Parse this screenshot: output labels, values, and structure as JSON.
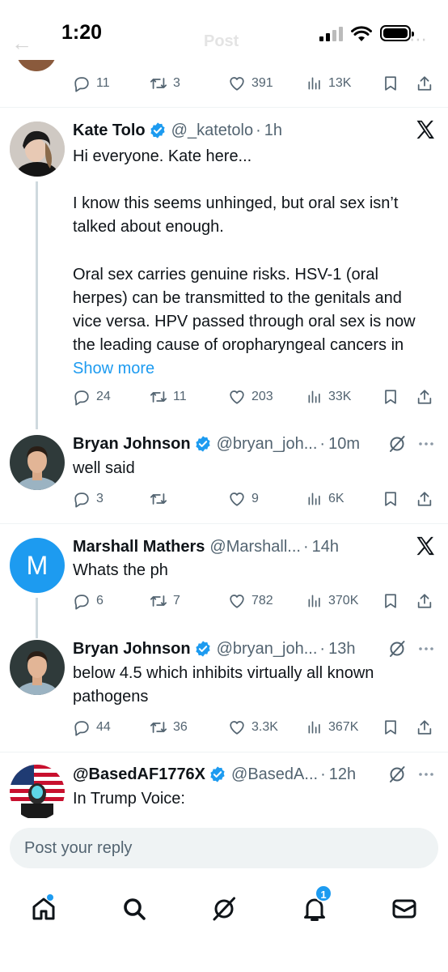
{
  "status_bar": {
    "time": "1:20"
  },
  "header": {
    "title": "Post"
  },
  "top_actions": {
    "replies": "11",
    "reposts": "3",
    "likes": "391",
    "views": "13K"
  },
  "tweets": [
    {
      "name": "Kate Tolo",
      "verified": true,
      "handle": "@_katetolo",
      "time": "1h",
      "paragraphs": [
        "Hi everyone. Kate here...",
        "I know this seems unhinged, but oral sex isn’t talked about enough.",
        "Oral sex carries genuine risks. HSV-1 (oral herpes) can be transmitted to the genitals and vice versa. HPV passed through oral sex is now the leading cause of oropharyngeal cancers in"
      ],
      "show_more": "Show more",
      "actions": {
        "replies": "24",
        "reposts": "11",
        "likes": "203",
        "views": "33K"
      }
    },
    {
      "name": "Bryan Johnson",
      "verified": true,
      "handle": "@bryan_joh...",
      "time": "10m",
      "text": "well said",
      "actions": {
        "replies": "3",
        "reposts": "",
        "likes": "9",
        "views": "6K"
      }
    },
    {
      "name": "Marshall Mathers",
      "verified": false,
      "handle": "@Marshall...",
      "time": "14h",
      "avatar_letter": "M",
      "text": "Whats the ph",
      "actions": {
        "replies": "6",
        "reposts": "7",
        "likes": "782",
        "views": "370K"
      }
    },
    {
      "name": "Bryan Johnson",
      "verified": true,
      "handle": "@bryan_joh...",
      "time": "13h",
      "text": "below 4.5 which inhibits virtually all known pathogens",
      "actions": {
        "replies": "44",
        "reposts": "36",
        "likes": "3.3K",
        "views": "367K"
      }
    },
    {
      "name": "@BasedAF1776X",
      "verified": true,
      "handle": "@BasedA...",
      "time": "12h",
      "text": "In Trump Voice:"
    }
  ],
  "reply_bar": {
    "placeholder": "Post your reply"
  },
  "tabbar": {
    "notifications_badge": "1"
  },
  "icons": [
    "home-icon",
    "search-icon",
    "grok-icon",
    "bell-icon",
    "mail-icon",
    "reply-icon",
    "repost-icon",
    "like-icon",
    "views-icon",
    "bookmark-icon",
    "share-icon",
    "x-logo-icon",
    "verified-icon",
    "more-icon"
  ],
  "colors": {
    "accent": "#1d9bf0",
    "secondary_text": "#536471",
    "divider": "#eff3f4",
    "thread_line": "#cfd9de",
    "marshall_avatar": "#1d9bf0"
  }
}
